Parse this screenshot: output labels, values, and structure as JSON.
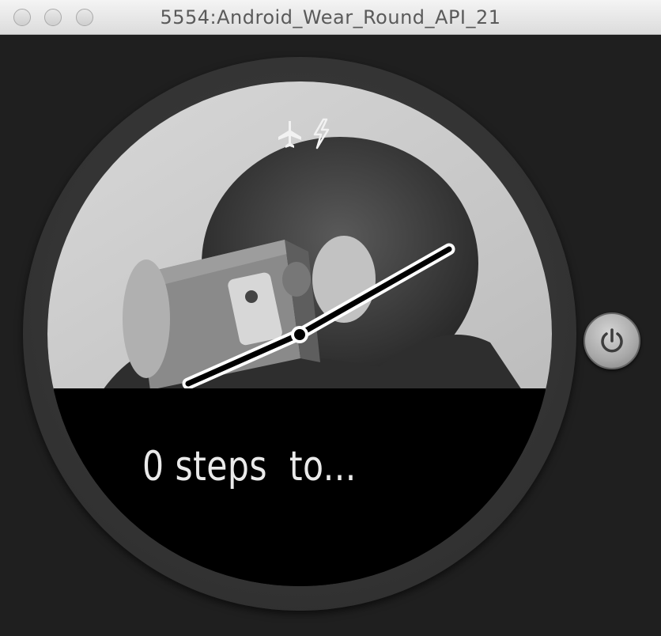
{
  "window": {
    "title": "5554:Android_Wear_Round_API_21"
  },
  "watch_face": {
    "status_icons": [
      "airplane-icon",
      "charging-bolt-icon"
    ],
    "step_text": "0 steps  to..."
  },
  "controls": {
    "power_icon": "power-icon"
  }
}
